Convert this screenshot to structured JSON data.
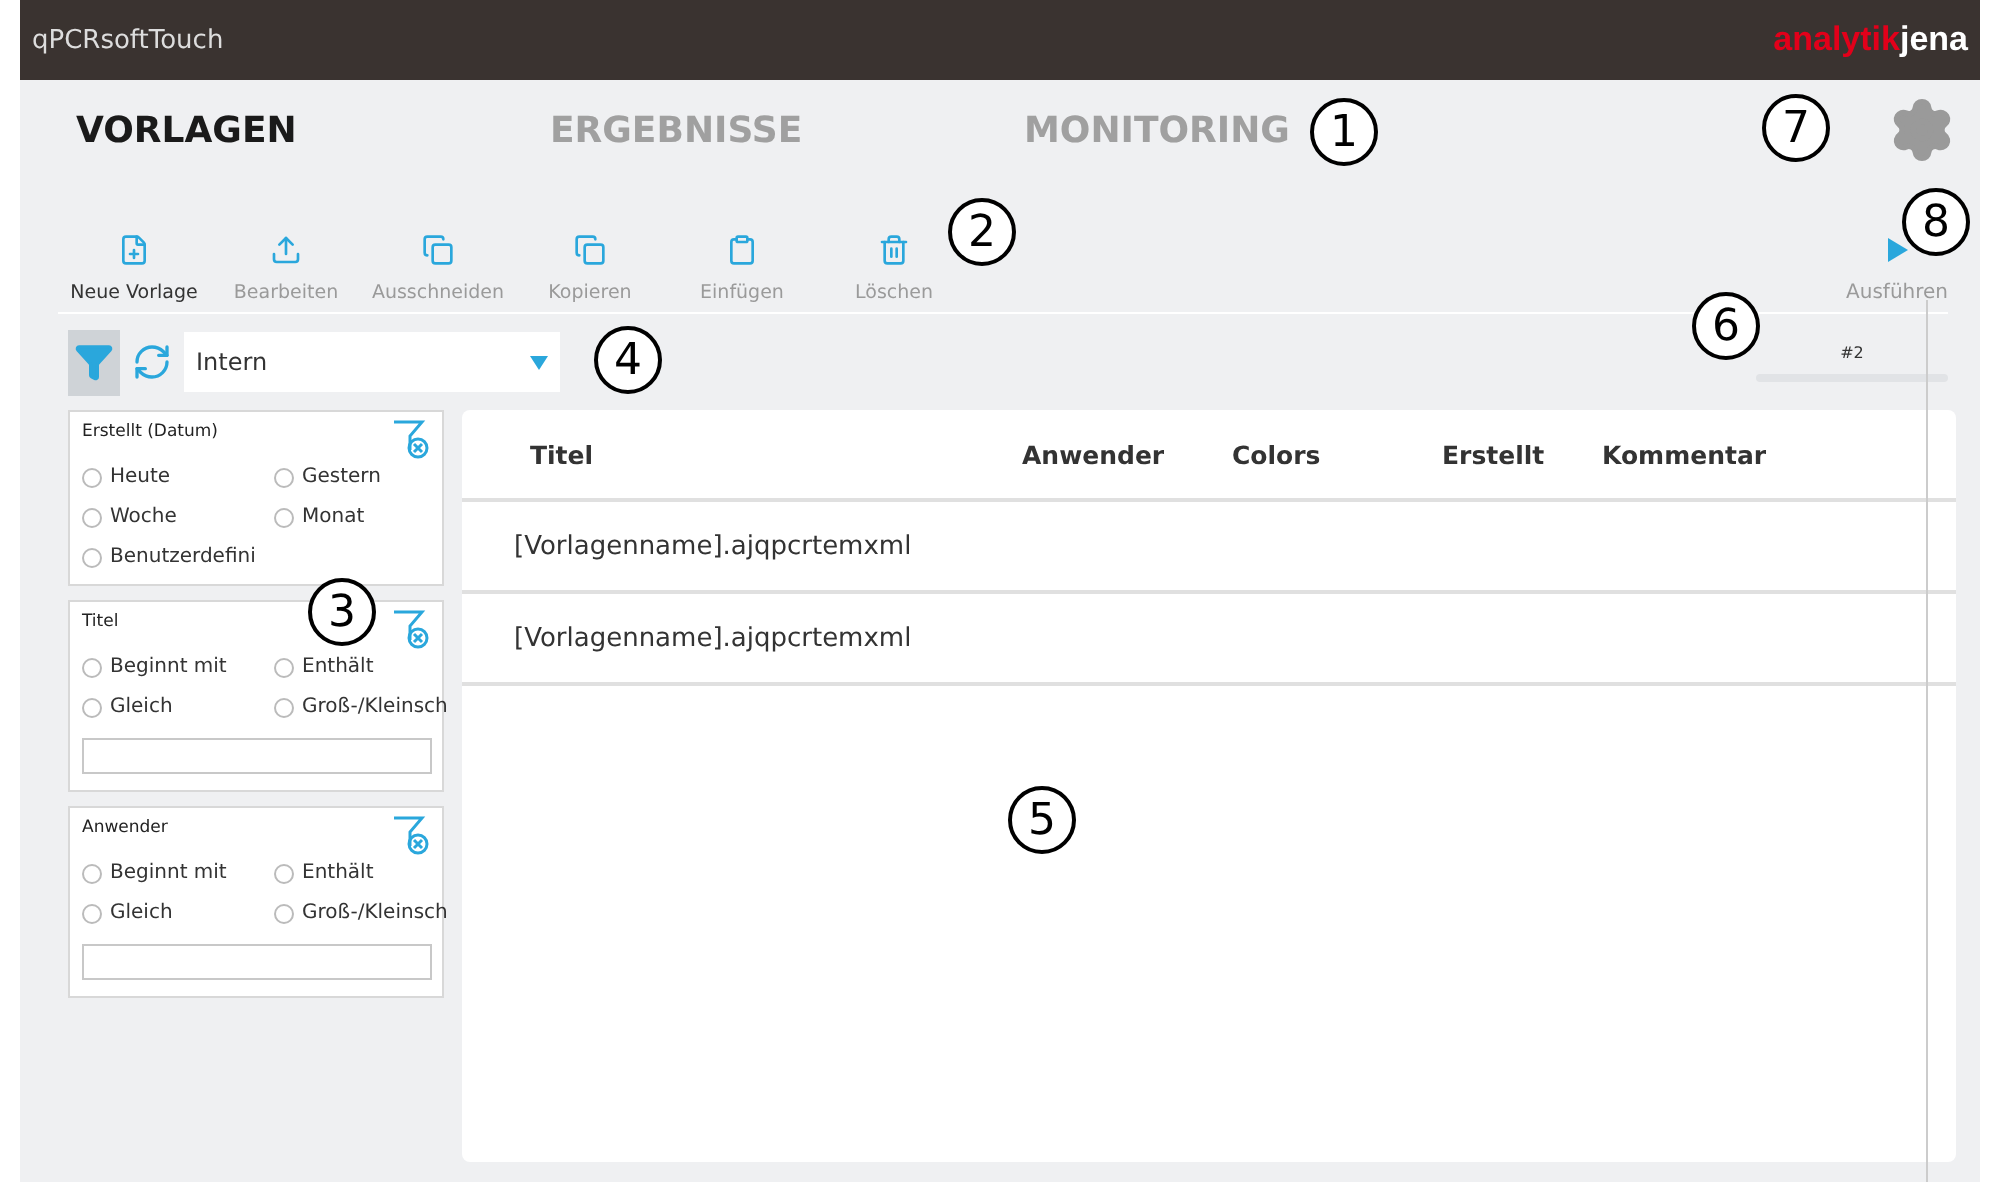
{
  "window": {
    "title": "qPCRsoftTouch",
    "logo": {
      "part_1": "analytik",
      "part_2": "jena"
    }
  },
  "tabs": [
    {
      "label": "VORLAGEN",
      "selected": true
    },
    {
      "label": "ERGEBNISSE",
      "selected": false
    },
    {
      "label": "MONITORING",
      "selected": false
    }
  ],
  "toolbar": [
    {
      "label": "Neue Vorlage",
      "kind": "new",
      "disabled": false
    },
    {
      "label": "Bearbeiten",
      "kind": "upload",
      "disabled": true
    },
    {
      "label": "Ausschneiden",
      "kind": "copy",
      "disabled": true
    },
    {
      "label": "Kopieren",
      "kind": "copy",
      "disabled": true
    },
    {
      "label": "Einfügen",
      "kind": "paste",
      "disabled": true
    },
    {
      "label": "Löschen",
      "kind": "delete",
      "disabled": true
    }
  ],
  "run_button": {
    "label": "Ausführen"
  },
  "filter_bar": {
    "filter_active": true,
    "dropdown": {
      "value": "Intern"
    },
    "page_label": "#2"
  },
  "filter_panels": [
    {
      "title": "Erstellt (Datum)",
      "options": [
        {
          "label": "Heute",
          "selected": false
        },
        {
          "label": "Gestern",
          "selected": false
        },
        {
          "label": "Woche",
          "selected": false
        },
        {
          "label": "Monat",
          "selected": false
        },
        {
          "label": "Benutzerdefini",
          "selected": false
        }
      ],
      "has_input": false
    },
    {
      "title": "Titel",
      "options": [
        {
          "label": "Beginnt mit",
          "selected": false
        },
        {
          "label": "Enthält",
          "selected": false
        },
        {
          "label": "Gleich",
          "selected": false
        },
        {
          "label": "Groß-/Kleinsch",
          "selected": false
        }
      ],
      "has_input": true
    },
    {
      "title": "Anwender",
      "options": [
        {
          "label": "Beginnt mit",
          "selected": false
        },
        {
          "label": "Enthält",
          "selected": false
        },
        {
          "label": "Gleich",
          "selected": false
        },
        {
          "label": "Groß-/Kleinsch",
          "selected": false
        }
      ],
      "has_input": true
    }
  ],
  "table": {
    "columns": [
      "Titel",
      "Anwender",
      "Colors",
      "Erstellt",
      "Kommentar"
    ],
    "rows": [
      [
        "[Vorlagenname].ajqpcrtemxml"
      ],
      [
        "[Vorlagenname].ajqpcrtemxml"
      ]
    ]
  },
  "callouts": [
    "1",
    "2",
    "3",
    "4",
    "5",
    "6",
    "7",
    "8"
  ]
}
